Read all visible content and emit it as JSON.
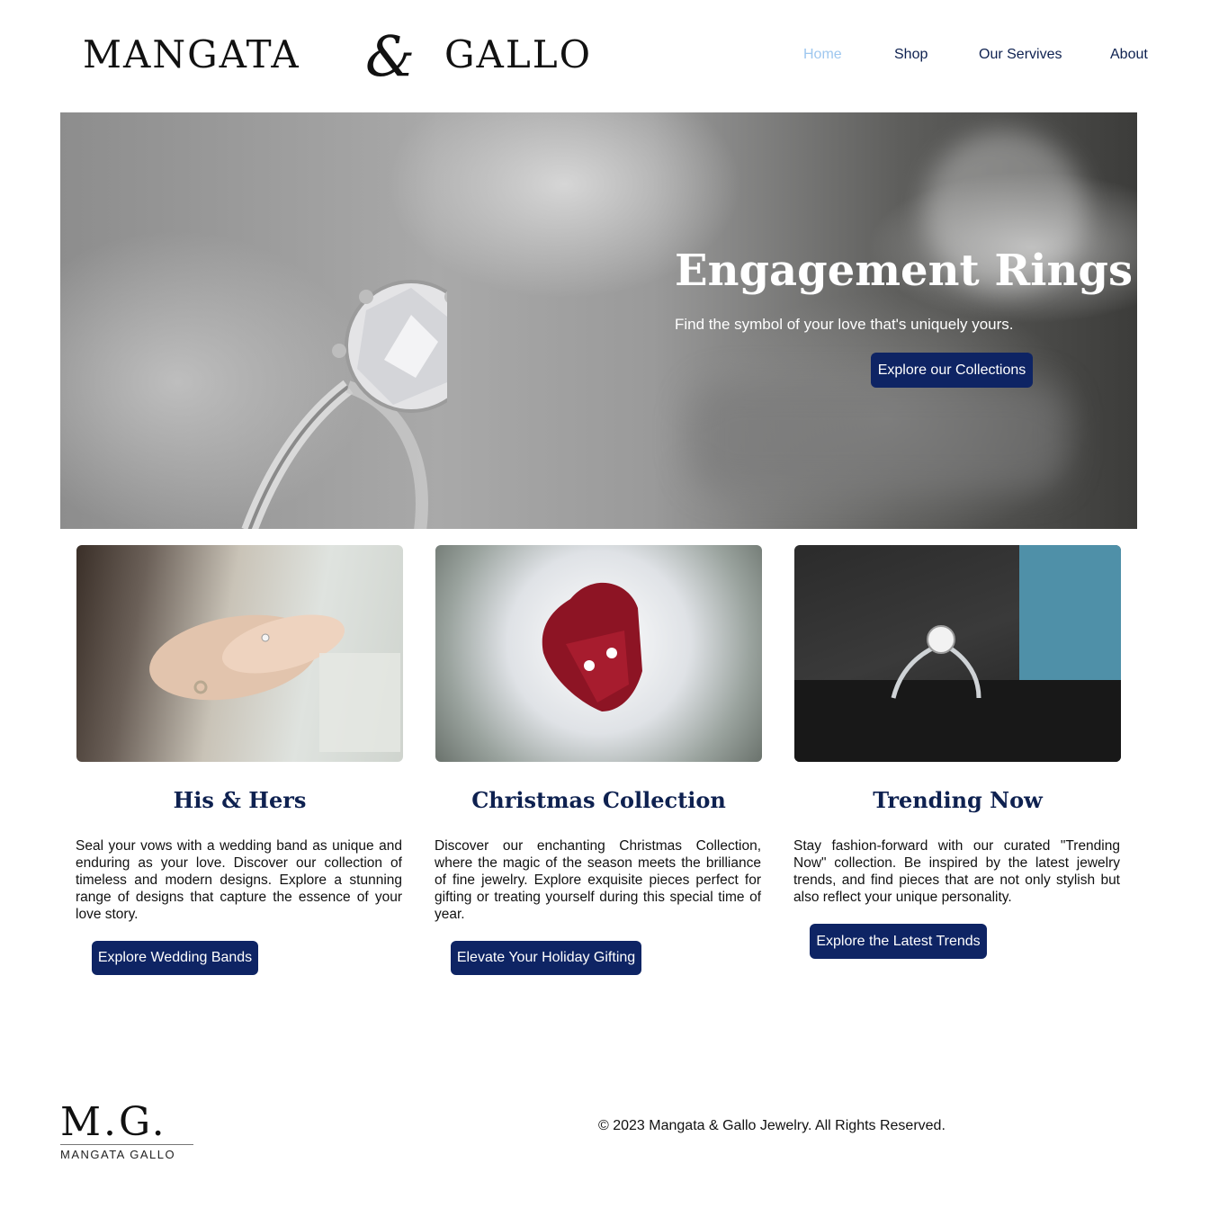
{
  "header": {
    "logo": {
      "word1": "MANGATA",
      "amp": "&",
      "word2": "GALLO"
    },
    "nav": [
      {
        "label": "Home",
        "active": true
      },
      {
        "label": "Shop",
        "active": false
      },
      {
        "label": "Our Servives",
        "active": false
      },
      {
        "label": "About",
        "active": false
      }
    ]
  },
  "hero": {
    "title": "Engagement Rings",
    "subtitle": "Find the symbol of your love that's uniquely yours.",
    "cta": "Explore our Collections"
  },
  "cards": [
    {
      "title": "His & Hers",
      "text": "Seal your vows with a wedding band as unique and enduring as your love. Discover our collection of timeless and modern designs. Explore a stunning range of designs that capture the essence of your love story.",
      "cta": "Explore Wedding Bands"
    },
    {
      "title": "Christmas Collection",
      "text": "Discover our enchanting Christmas Collection, where the magic of the season meets the brilliance of fine jewelry. Explore exquisite pieces perfect for gifting or treating yourself during this special time of year.",
      "cta": "Elevate Your Holiday Gifting"
    },
    {
      "title": "Trending Now",
      "text": "Stay fashion-forward with our curated \"Trending Now\" collection. Be inspired by the latest jewelry trends, and find pieces that are not only stylish but also reflect your unique personality.",
      "cta": "Explore the Latest Trends"
    }
  ],
  "footer": {
    "logo_mark": "M.G.",
    "logo_sub": "MANGATA GALLO",
    "copyright": "© 2023 Mangata & Gallo Jewelry. All Rights Reserved."
  },
  "colors": {
    "brand_navy": "#0e2464",
    "nav_text": "#0e2150",
    "nav_active": "#9ec7ef",
    "background": "#ffffff"
  }
}
